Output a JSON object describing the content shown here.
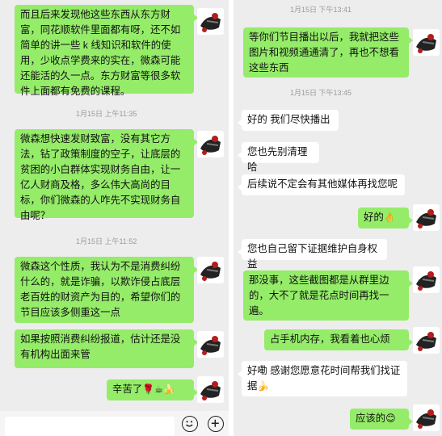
{
  "left_panel": {
    "messages": [
      {
        "type": "text",
        "text": "而且后来发现他这些东西从东方财富，同花顺软件里面都有呀，还不如简单的讲一些 k 线知识和软件的使用，少收点学费来的实在，微森可能还能活的久一点。东方财富等很多软件上面都有免费的课程。"
      },
      {
        "type": "timestamp",
        "text": "1月15日 上午11:35"
      },
      {
        "type": "text",
        "text": "微森想快速发财致富，没有其它方法，钻了政策制度的空子，让底层的贫困的小白群体实现财务自由，让一亿人财商及格，多么伟大高尚的目标，你们微森的人咋先不实现财务自由呢？"
      },
      {
        "type": "timestamp",
        "text": "1月15日 上午11:52"
      },
      {
        "type": "text",
        "text": "微森这个性质，我认为不是消费纠纷什么的，就是诈骗，以欺诈侵占底层老百姓的财资产为目的，希望你们的节目应该多侧重这一点"
      },
      {
        "type": "text",
        "text": "如果按照消费纠纷报道，估计还是没有机构出面来管"
      },
      {
        "type": "text",
        "text": "辛苦了",
        "emoji": "🌹☕🍌"
      }
    ],
    "input": {
      "emoji_icon": "smile-icon",
      "plus_icon": "plus-icon"
    }
  },
  "right_panel": {
    "messages": [
      {
        "type": "timestamp",
        "text": "1月15日 下午13:41"
      },
      {
        "type": "text",
        "text": "等你们节目播出以后，我就把这些图片和视频通通清了，再也不想看这些东西"
      },
      {
        "type": "timestamp",
        "text": "1月15日 下午13:45"
      },
      {
        "type": "text",
        "text": "好的 我们尽快播出"
      },
      {
        "type": "text",
        "text": "您也先别清理哈"
      },
      {
        "type": "text",
        "text": "后续说不定会有其他媒体再找您呢"
      },
      {
        "type": "text",
        "text": "好的",
        "emoji": "👌"
      },
      {
        "type": "text",
        "text": "您也自己留下证据维护自身权益"
      },
      {
        "type": "text",
        "text": "那没事，这些截图都是从群里边的，大不了就是花点时间再找一遍。"
      },
      {
        "type": "text",
        "text": "占手机内存，我看着也心烦"
      },
      {
        "type": "text",
        "text": "好嘞 感谢您愿意花时间帮我们找证据",
        "emoji": "🍌"
      },
      {
        "type": "text",
        "text": "应该的",
        "emoji": "😊"
      }
    ]
  },
  "colors": {
    "outgoing_bubble": "#95ec69",
    "incoming_bubble": "#ffffff",
    "background": "#ededed",
    "timestamp": "#9a9a9a"
  }
}
